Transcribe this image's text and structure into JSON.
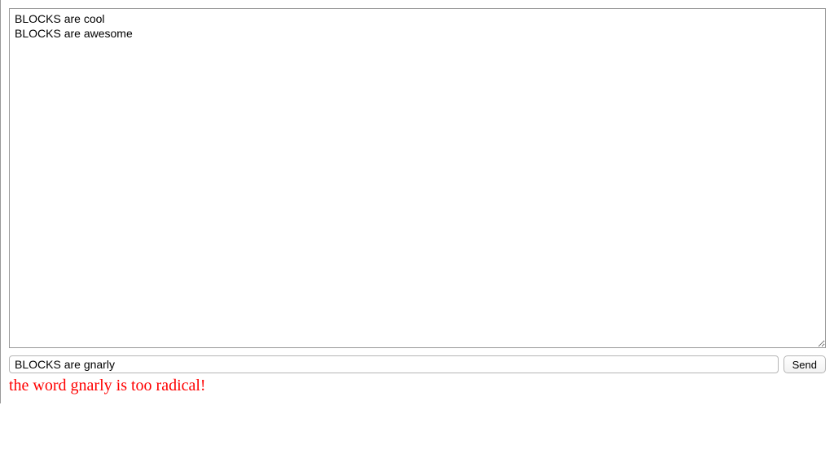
{
  "chat": {
    "log": "BLOCKS are cool\nBLOCKS are awesome",
    "input_value": "BLOCKS are gnarly",
    "send_label": "Send",
    "error": "the word gnarly is too radical!"
  }
}
